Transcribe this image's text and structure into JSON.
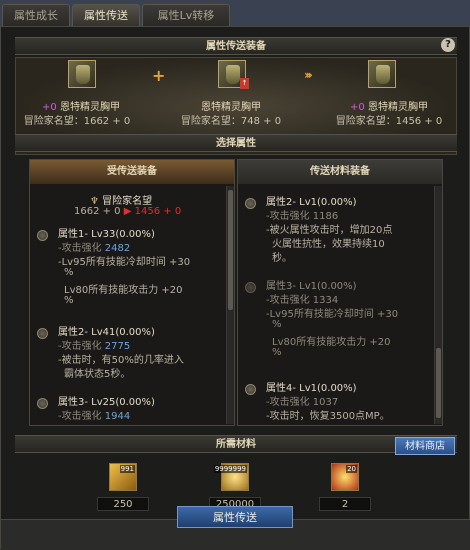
{
  "tabs": [
    {
      "label": "属性成长"
    },
    {
      "label": "属性传送"
    },
    {
      "label": "属性Lv转移"
    }
  ],
  "header": {
    "title": "属性传送装备",
    "help": "?"
  },
  "transfer": {
    "items": [
      {
        "upgrade": "+0",
        "name": "恩特精灵胸甲",
        "reputation": "冒险家名望：1662 + 0"
      },
      {
        "upgrade": "",
        "name": "恩特精灵胸甲",
        "reputation": "冒险家名望：748 + 0"
      },
      {
        "upgrade": "+0",
        "name": "恩特精灵胸甲",
        "reputation": "冒险家名望：1456 + 0"
      }
    ],
    "plus": "+",
    "arrows": "›››"
  },
  "select": {
    "title": "选择属性"
  },
  "left_panel": {
    "title": "受传送装备",
    "reputation_label": "冒险家名望",
    "reputation_from": "1662 + 0",
    "reputation_to": "1456 + 0",
    "attrs": [
      {
        "title": "属性1- Lv33(0.00%)",
        "stat": "-攻击强化",
        "value": "2482",
        "lines": [
          "-Lv95所有技能冷却时间 +30",
          "%",
          "Lv80所有技能攻击力 +20",
          "%"
        ]
      },
      {
        "title": "属性2- Lv41(0.00%)",
        "stat": "-攻击强化",
        "value": "2775",
        "lines": [
          "-被击时，有50%的几率进入",
          "霸体状态5秒。"
        ]
      },
      {
        "title": "属性3- Lv25(0.00%)",
        "stat": "-攻击强化",
        "value": "1944",
        "lines": []
      }
    ]
  },
  "right_panel": {
    "title": "传送材料装备",
    "attrs": [
      {
        "title": "属性2- Lv1(0.00%)",
        "stat": "-攻击强化 1186",
        "lines": [
          "-被火属性攻击时，增加20点",
          "火属性抗性，效果持续10",
          "秒。"
        ]
      },
      {
        "title": "属性3- Lv1(0.00%)",
        "stat": "-攻击强化 1334",
        "lines": [
          "-Lv95所有技能冷却时间 +30",
          "%",
          "Lv80所有技能攻击力 +20",
          "%"
        ]
      },
      {
        "title": "属性4- Lv1(0.00%)",
        "stat": "-攻击强化 1037",
        "lines": [
          "-攻击时，恢复3500点MP。"
        ]
      }
    ]
  },
  "materials": {
    "title": "所需材料",
    "shop_label": "材料商店",
    "items": [
      {
        "count": "991",
        "required": "250",
        "color": "#d79b2a"
      },
      {
        "count": "9999999",
        "required": "250000",
        "color": "#c9a02b"
      },
      {
        "count": "20",
        "required": "2",
        "color": "#c44a1f"
      }
    ]
  },
  "footer": {
    "button_label": "属性传送"
  },
  "colors": {
    "arrow_red": "#e0302a",
    "value_blue": "#6fa4d8",
    "upgrade_purple": "#d05cd8",
    "gold": "#e1a43d"
  }
}
